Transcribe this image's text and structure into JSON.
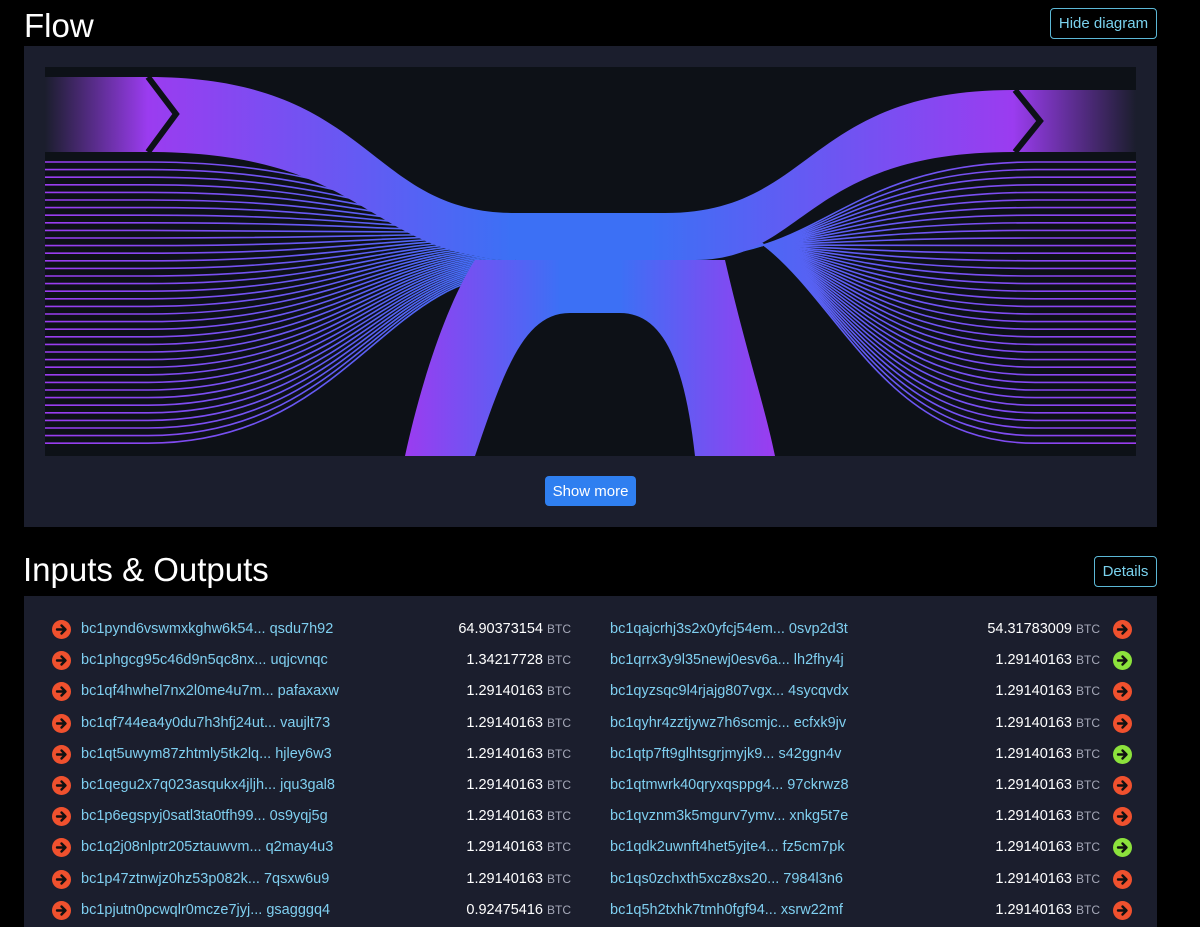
{
  "flow": {
    "title": "Flow",
    "hide_label": "Hide diagram",
    "show_more_label": "Show more",
    "colors": {
      "start": "#9b3cf0",
      "end": "#2d7cf7",
      "background": "#0d1117"
    }
  },
  "io": {
    "title": "Inputs & Outputs",
    "details_label": "Details",
    "unit": "BTC",
    "inputs": [
      {
        "addr_start": "bc1pynd6vswmxkghw6k54...",
        "addr_end": "qsdu7h92",
        "amount": "64.90373154",
        "icon": "arrow-right-icon"
      },
      {
        "addr_start": "bc1phgcg95c46d9n5qc8nx...",
        "addr_end": "uqjcvnqc",
        "amount": "1.34217728",
        "icon": "arrow-right-icon"
      },
      {
        "addr_start": "bc1qf4hwhel7nx2l0me4u7m...",
        "addr_end": "pafaxaxw",
        "amount": "1.29140163",
        "icon": "arrow-right-icon"
      },
      {
        "addr_start": "bc1qf744ea4y0du7h3hfj24ut...",
        "addr_end": "vaujlt73",
        "amount": "1.29140163",
        "icon": "arrow-right-icon"
      },
      {
        "addr_start": "bc1qt5uwym87zhtmly5tk2lq...",
        "addr_end": "hjley6w3",
        "amount": "1.29140163",
        "icon": "arrow-right-icon"
      },
      {
        "addr_start": "bc1qegu2x7q023asqukx4jljh...",
        "addr_end": "jqu3gal8",
        "amount": "1.29140163",
        "icon": "arrow-right-icon"
      },
      {
        "addr_start": "bc1p6egspyj0satl3ta0tfh99...",
        "addr_end": "0s9yqj5g",
        "amount": "1.29140163",
        "icon": "arrow-right-icon"
      },
      {
        "addr_start": "bc1q2j08nlptr205ztauwvm...",
        "addr_end": "q2may4u3",
        "amount": "1.29140163",
        "icon": "arrow-right-icon"
      },
      {
        "addr_start": "bc1p47ztnwjz0hz53p082k...",
        "addr_end": "7qsxw6u9",
        "amount": "1.29140163",
        "icon": "arrow-right-icon"
      },
      {
        "addr_start": "bc1pjutn0pcwqlr0mcze7jyj...",
        "addr_end": "gsagggq4",
        "amount": "0.92475416",
        "icon": "arrow-right-icon"
      }
    ],
    "outputs": [
      {
        "addr_start": "bc1qajcrhj3s2x0yfcj54em...",
        "addr_end": "0svp2d3t",
        "amount": "54.31783009",
        "status": "spent",
        "icon": "arrow-right-icon"
      },
      {
        "addr_start": "bc1qrrx3y9l35newj0esv6a...",
        "addr_end": "lh2fhy4j",
        "amount": "1.29140163",
        "status": "unspent",
        "icon": "arrow-right-icon"
      },
      {
        "addr_start": "bc1qyzsqc9l4rjajg807vgx...",
        "addr_end": "4sycqvdx",
        "amount": "1.29140163",
        "status": "spent",
        "icon": "arrow-right-icon"
      },
      {
        "addr_start": "bc1qyhr4zztjywz7h6scmjc...",
        "addr_end": "ecfxk9jv",
        "amount": "1.29140163",
        "status": "spent",
        "icon": "arrow-right-icon"
      },
      {
        "addr_start": "bc1qtp7ft9glhtsgrjmyjk9...",
        "addr_end": "s42ggn4v",
        "amount": "1.29140163",
        "status": "unspent",
        "icon": "arrow-right-icon"
      },
      {
        "addr_start": "bc1qtmwrk40qryxqsppg4...",
        "addr_end": "97ckrwz8",
        "amount": "1.29140163",
        "status": "spent",
        "icon": "arrow-right-icon"
      },
      {
        "addr_start": "bc1qvznm3k5mgurv7ymv...",
        "addr_end": "xnkg5t7e",
        "amount": "1.29140163",
        "status": "spent",
        "icon": "arrow-right-icon"
      },
      {
        "addr_start": "bc1qdk2uwnft4het5yjte4...",
        "addr_end": "fz5cm7pk",
        "amount": "1.29140163",
        "status": "unspent",
        "icon": "arrow-right-icon"
      },
      {
        "addr_start": "bc1qs0zchxth5xcz8xs20...",
        "addr_end": "7984l3n6",
        "amount": "1.29140163",
        "status": "spent",
        "icon": "arrow-right-icon"
      },
      {
        "addr_start": "bc1q5h2txhk7tmh0fgf94...",
        "addr_end": "xsrw22mf",
        "amount": "1.29140163",
        "status": "spent",
        "icon": "arrow-right-icon"
      }
    ],
    "colors": {
      "spent": "#f0512e",
      "unspent": "#8ce23c",
      "address": "#7fcff0"
    }
  }
}
